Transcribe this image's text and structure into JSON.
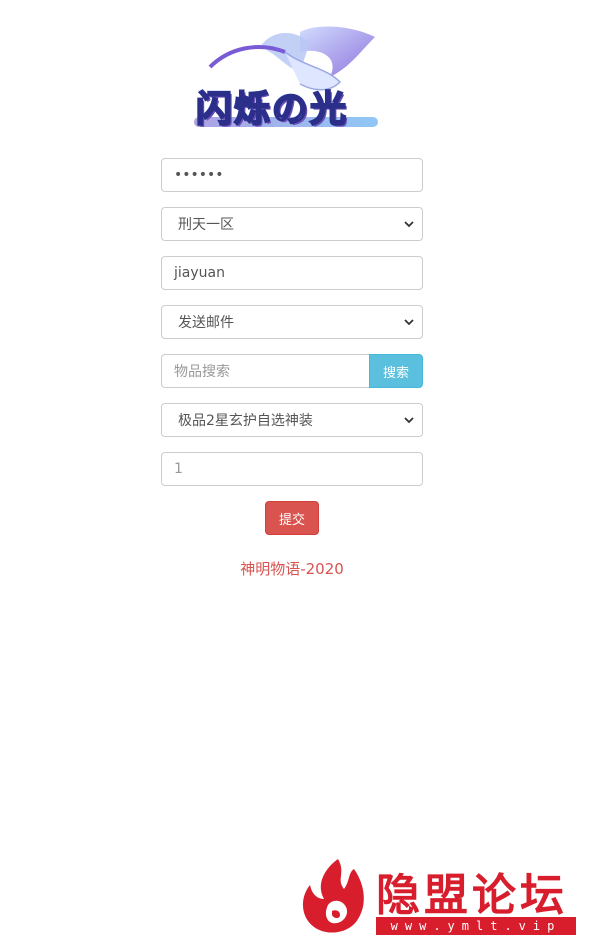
{
  "logo": {
    "alt_text": "闪烁の光"
  },
  "form": {
    "password_value": "••••••",
    "server_select": "刑天一区",
    "role_name_value": "jiayuan",
    "action_select": "发送邮件",
    "item_search_placeholder": "物品搜索",
    "search_button_label": "搜索",
    "item_select": "极品2星玄护自选神装",
    "quantity_placeholder": "1",
    "submit_button_label": "提交"
  },
  "footer": {
    "text": "神明物语-2020"
  },
  "watermark": {
    "title": "隐盟论坛",
    "url": "www.ymlt.vip",
    "color": "#d81e2c"
  },
  "colors": {
    "info": "#5bc0de",
    "danger": "#d9534f"
  }
}
